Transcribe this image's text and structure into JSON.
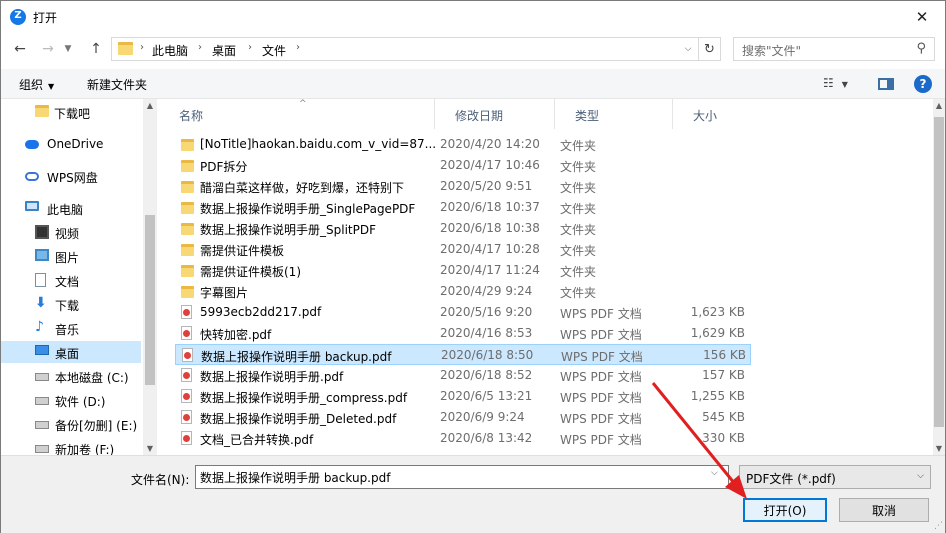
{
  "window": {
    "title": "打开"
  },
  "nav": {
    "breadcrumb": [
      "此电脑",
      "桌面",
      "文件"
    ],
    "search_placeholder": "搜索\"文件\""
  },
  "toolbar": {
    "organize": "组织",
    "new_folder": "新建文件夹"
  },
  "sidebar": {
    "items": [
      {
        "label": "下载吧",
        "icon": "folder-icon"
      },
      {
        "label": "OneDrive",
        "icon": "onedrive-cloud-icon"
      },
      {
        "label": "WPS网盘",
        "icon": "wps-cloud-icon"
      },
      {
        "label": "此电脑",
        "icon": "computer-icon"
      },
      {
        "label": "视频",
        "icon": "video-icon"
      },
      {
        "label": "图片",
        "icon": "picture-icon"
      },
      {
        "label": "文档",
        "icon": "document-icon"
      },
      {
        "label": "下载",
        "icon": "download-icon"
      },
      {
        "label": "音乐",
        "icon": "music-icon"
      },
      {
        "label": "桌面",
        "icon": "desktop-icon",
        "selected": true
      },
      {
        "label": "本地磁盘 (C:)",
        "icon": "drive-icon"
      },
      {
        "label": "软件 (D:)",
        "icon": "drive-icon"
      },
      {
        "label": "备份[勿删] (E:)",
        "icon": "drive-icon"
      },
      {
        "label": "新加卷 (F:)",
        "icon": "drive-icon"
      }
    ]
  },
  "columns": {
    "name": "名称",
    "date": "修改日期",
    "type": "类型",
    "size": "大小"
  },
  "files": [
    {
      "name": "[NoTitle]haokan.baidu.com_v_vid=87...",
      "date": "2020/4/20 14:20",
      "type": "文件夹",
      "size": "",
      "kind": "folder"
    },
    {
      "name": "PDF拆分",
      "date": "2020/4/17 10:46",
      "type": "文件夹",
      "size": "",
      "kind": "folder"
    },
    {
      "name": "醋溜白菜这样做，好吃到爆，还特别下",
      "date": "2020/5/20 9:51",
      "type": "文件夹",
      "size": "",
      "kind": "folder"
    },
    {
      "name": "数据上报操作说明手册_SinglePagePDF",
      "date": "2020/6/18 10:37",
      "type": "文件夹",
      "size": "",
      "kind": "folder"
    },
    {
      "name": "数据上报操作说明手册_SplitPDF",
      "date": "2020/6/18 10:38",
      "type": "文件夹",
      "size": "",
      "kind": "folder"
    },
    {
      "name": "需提供证件模板",
      "date": "2020/4/17 10:28",
      "type": "文件夹",
      "size": "",
      "kind": "folder"
    },
    {
      "name": "需提供证件模板(1)",
      "date": "2020/4/17 11:24",
      "type": "文件夹",
      "size": "",
      "kind": "folder"
    },
    {
      "name": "字幕图片",
      "date": "2020/4/29 9:24",
      "type": "文件夹",
      "size": "",
      "kind": "folder"
    },
    {
      "name": "5993ecb2dd217.pdf",
      "date": "2020/5/16 9:20",
      "type": "WPS PDF 文档",
      "size": "1,623 KB",
      "kind": "pdf"
    },
    {
      "name": "快转加密.pdf",
      "date": "2020/4/16 8:53",
      "type": "WPS PDF 文档",
      "size": "1,629 KB",
      "kind": "pdf"
    },
    {
      "name": "数据上报操作说明手册 backup.pdf",
      "date": "2020/6/18 8:50",
      "type": "WPS PDF 文档",
      "size": "156 KB",
      "kind": "pdf",
      "selected": true
    },
    {
      "name": "数据上报操作说明手册.pdf",
      "date": "2020/6/18 8:52",
      "type": "WPS PDF 文档",
      "size": "157 KB",
      "kind": "pdf"
    },
    {
      "name": "数据上报操作说明手册_compress.pdf",
      "date": "2020/6/5 13:21",
      "type": "WPS PDF 文档",
      "size": "1,255 KB",
      "kind": "pdf"
    },
    {
      "name": "数据上报操作说明手册_Deleted.pdf",
      "date": "2020/6/9 9:24",
      "type": "WPS PDF 文档",
      "size": "545 KB",
      "kind": "pdf"
    },
    {
      "name": "文档_已合并转换.pdf",
      "date": "2020/6/8 13:42",
      "type": "WPS PDF 文档",
      "size": "330 KB",
      "kind": "pdf"
    }
  ],
  "footer": {
    "filename_label": "文件名(N):",
    "filename_value": "数据上报操作说明手册 backup.pdf",
    "filetype": "PDF文件 (*.pdf)",
    "open": "打开(O)",
    "cancel": "取消"
  },
  "colors": {
    "accent": "#0078d7",
    "selection": "#cce8ff",
    "arrow": "#e02020"
  }
}
